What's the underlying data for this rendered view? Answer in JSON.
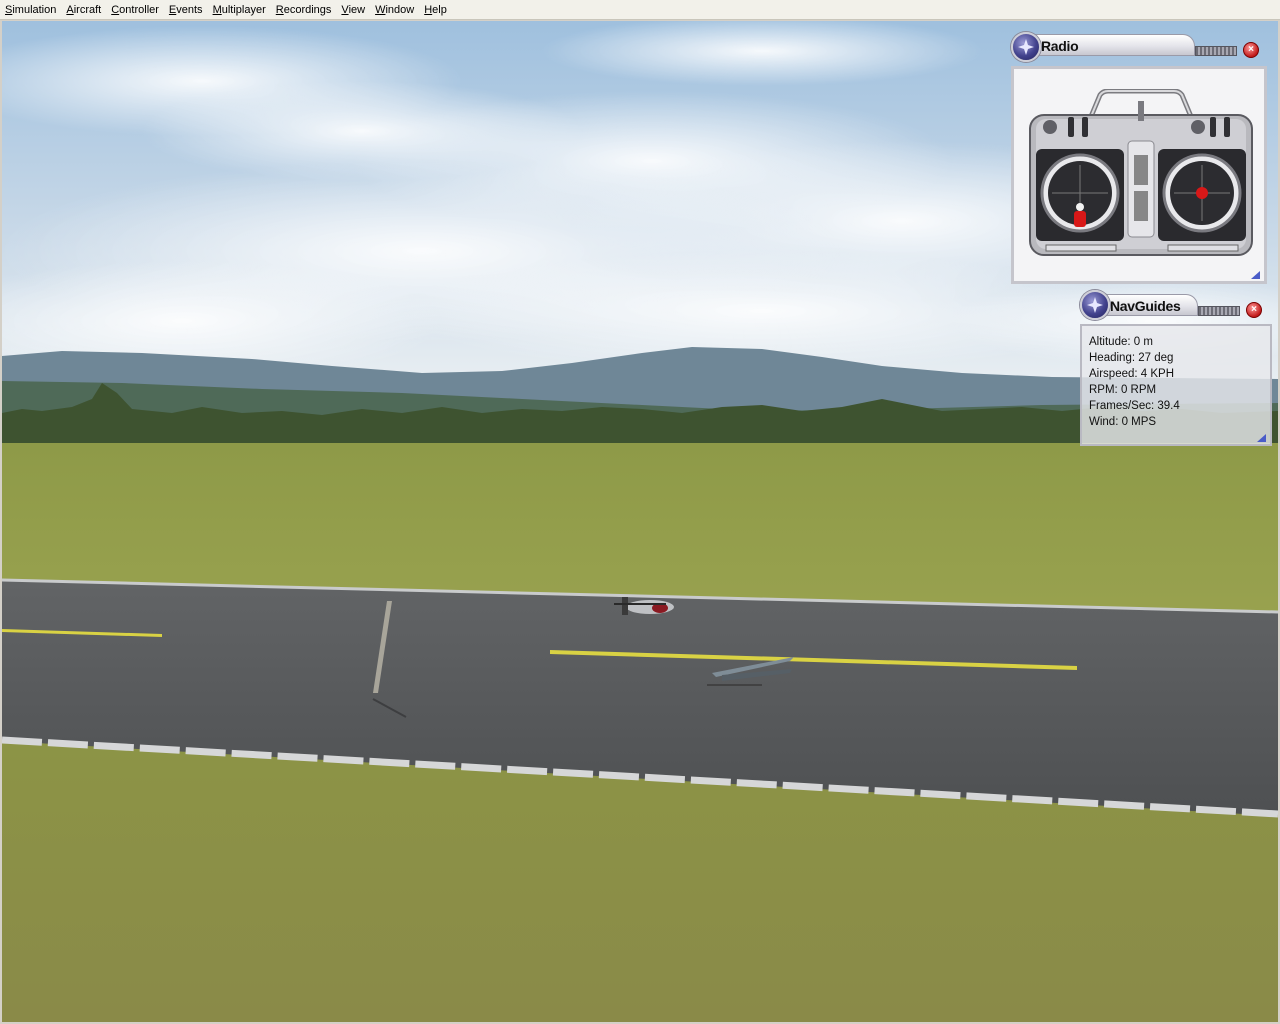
{
  "menubar": {
    "items": [
      "Simulation",
      "Aircraft",
      "Controller",
      "Events",
      "Multiplayer",
      "Recordings",
      "View",
      "Window",
      "Help"
    ]
  },
  "radio_window": {
    "title": "Radio",
    "close_glyph": "×"
  },
  "navguides_window": {
    "title": "NavGuides",
    "close_glyph": "×",
    "readouts": [
      "Altitude: 0 m",
      "Heading: 27 deg",
      "Airspeed: 4 KPH",
      "RPM: 0 RPM",
      "Frames/Sec: 39.4",
      "Wind: 0 MPS"
    ]
  },
  "colors": {
    "menubar_bg": "#f2f1ea",
    "sky_top": "#a9c7e2",
    "grass": "#8f9a45",
    "runway": "#5a5c5e",
    "runway_line": "#e3d94a",
    "stick_red": "#d81818"
  },
  "icons": [
    "logo-badge-icon",
    "close-icon",
    "resize-grip-icon"
  ]
}
